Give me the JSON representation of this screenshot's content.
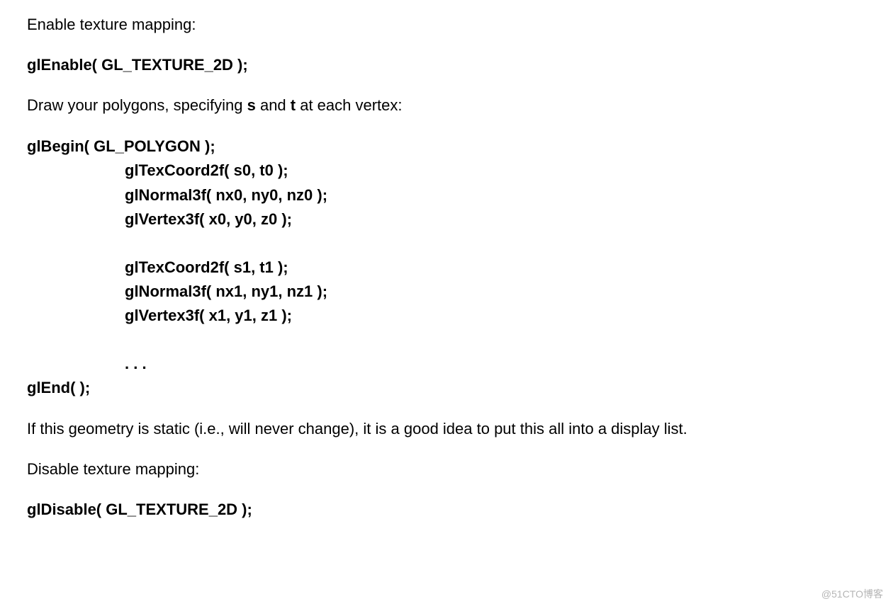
{
  "paragraphs": {
    "enable_texture": "Enable texture mapping:",
    "gl_enable": "glEnable( GL_TEXTURE_2D );",
    "draw_polygons_prefix": "Draw your polygons, specifying ",
    "draw_polygons_s": "s",
    "draw_polygons_mid": " and ",
    "draw_polygons_t": "t",
    "draw_polygons_suffix": " at each vertex:",
    "code": {
      "begin": "glBegin( GL_POLYGON );",
      "texcoord0": "glTexCoord2f( s0, t0 );",
      "normal0": "glNormal3f( nx0, ny0, nz0 );",
      "vertex0": "glVertex3f( x0, y0, z0 );",
      "blank1": "",
      "texcoord1": "glTexCoord2f( s1, t1 );",
      "normal1": "glNormal3f( nx1, ny1, nz1 );",
      "vertex1": "glVertex3f( x1, y1, z1 );",
      "blank2": "",
      "ellipsis": ". . .",
      "end": "glEnd( );"
    },
    "static_geometry": "If this geometry is static (i.e., will never change), it is a good idea to put this all into a display list.",
    "disable_texture": "Disable texture mapping:",
    "gl_disable": "glDisable( GL_TEXTURE_2D );"
  },
  "watermark": "@51CTO博客"
}
